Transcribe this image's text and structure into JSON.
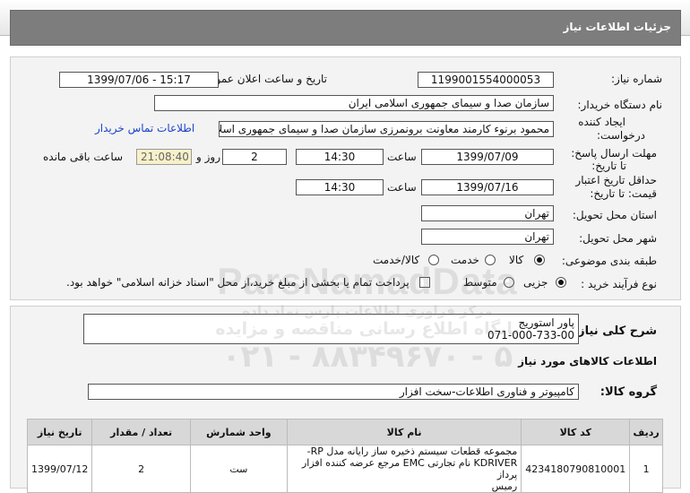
{
  "header": {
    "title": "جزئیات اطلاعات نیاز"
  },
  "form": {
    "need_number_label": "شماره نیاز:",
    "need_number": "1199001554000053",
    "announce_label": "تاریخ و ساعت اعلان عمومی:",
    "announce_value": "1399/07/06 - 15:17",
    "buyer_label": "نام دستگاه خریدار:",
    "buyer_value": "سازمان صدا و سیمای جمهوری اسلامی ایران",
    "creator_label_1": "ایجاد کننده",
    "creator_label_2": "درخواست:",
    "creator_value": "محمود برنوء کارمند معاونت برونمرزی سازمان صدا و سیمای جمهوری اسلامی ایران",
    "contact_link": "اطلاعات تماس خریدار",
    "deadline_label_1": "مهلت ارسال پاسخ:",
    "deadline_label_2": "تا تاریخ:",
    "deadline_date": "1399/07/09",
    "time_label": "ساعت",
    "deadline_time": "14:30",
    "days_value": "2",
    "days_label": "روز و",
    "remaining_time": "21:08:40",
    "remaining_label": "ساعت باقی مانده",
    "validity_label_1": "حداقل تاریخ اعتبار",
    "validity_label_2": "قیمت: تا تاریخ:",
    "validity_date": "1399/07/16",
    "validity_time_label": "ساعت",
    "validity_time": "14:30",
    "province_label": "استان محل تحویل:",
    "province_value": "تهران",
    "city_label": "شهر محل تحویل:",
    "city_value": "تهران",
    "category_label": "طبقه بندی موضوعی:",
    "category_options": [
      "کالا",
      "خدمت",
      "کالا/خدمت"
    ],
    "purchase_label": "نوع فرآیند خرید :",
    "purchase_options": [
      "جزیی",
      "متوسط"
    ],
    "payment_note": "پرداخت تمام یا بخشی از مبلغ خرید،از محل \"اسناد خزانه اسلامی\" خواهد بود."
  },
  "summary": {
    "label": "شرح کلی نیاز:",
    "line1": "پاور استوریج",
    "line2": "071-000-733-00"
  },
  "goods": {
    "section_title": "اطلاعات کالاهای مورد نیاز",
    "group_label": "گروه کالا:",
    "group_value": "کامپیوتر و فناوری اطلاعات-سخت افزار"
  },
  "table": {
    "headers": [
      "ردیف",
      "کد کالا",
      "نام کالا",
      "واحد شمارش",
      "تعداد / مقدار",
      "تاریخ نیاز"
    ],
    "rows": [
      {
        "row": "1",
        "code": "4234180790810001",
        "name_1": "مجموعه قطعات سیستم ذخیره ساز رایانه مدل RP-",
        "name_2": "KDRIVER نام تجارتی EMC مرجع عرضه کننده افزار پرداز",
        "name_3": "رمیس",
        "unit": "ست",
        "qty": "2",
        "date": "1399/07/12"
      }
    ]
  },
  "watermark": {
    "brand": "ParsNamadData",
    "line1": "مرکز فراوری اطلاعات پارس نماد داده",
    "line2": "پایگاه اطلاع رسانی مناقصه و مزایده",
    "phone": "۰۲۱ - ۸۸۳۴۹۶۷۰ - ۵"
  }
}
